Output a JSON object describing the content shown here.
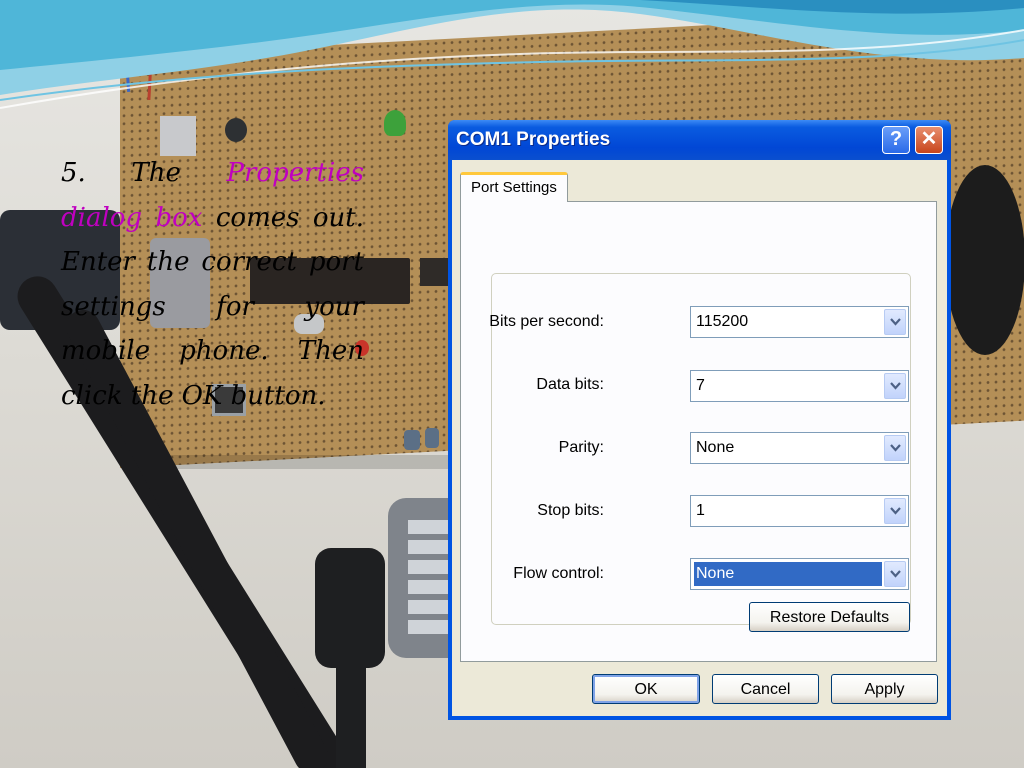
{
  "slide": {
    "step_number": "5.",
    "text_before": "The",
    "highlight": "Properties dialog box",
    "text_after": "comes out. Enter the correct port settings for your mobile phone. Then click the OK button.",
    "highlight_color": "#c000c0"
  },
  "dialog": {
    "title": "COM1 Properties",
    "help_button": "?",
    "close_button": "✕",
    "tab_label": "Port Settings",
    "fields": [
      {
        "label": "Bits per second:",
        "value": "115200"
      },
      {
        "label": "Data bits:",
        "value": "7"
      },
      {
        "label": "Parity:",
        "value": "None"
      },
      {
        "label": "Stop bits:",
        "value": "1"
      },
      {
        "label": "Flow control:",
        "value": "None",
        "focused": true
      }
    ],
    "restore_defaults_label": "Restore Defaults",
    "ok_label": "OK",
    "cancel_label": "Cancel",
    "apply_label": "Apply"
  },
  "icons": {
    "dropdown": "chevron-down-icon",
    "help": "help-icon",
    "close": "close-icon"
  },
  "colors": {
    "titlebar": "#0054e3",
    "selection": "#316ac5",
    "close_button": "#c8451c"
  }
}
